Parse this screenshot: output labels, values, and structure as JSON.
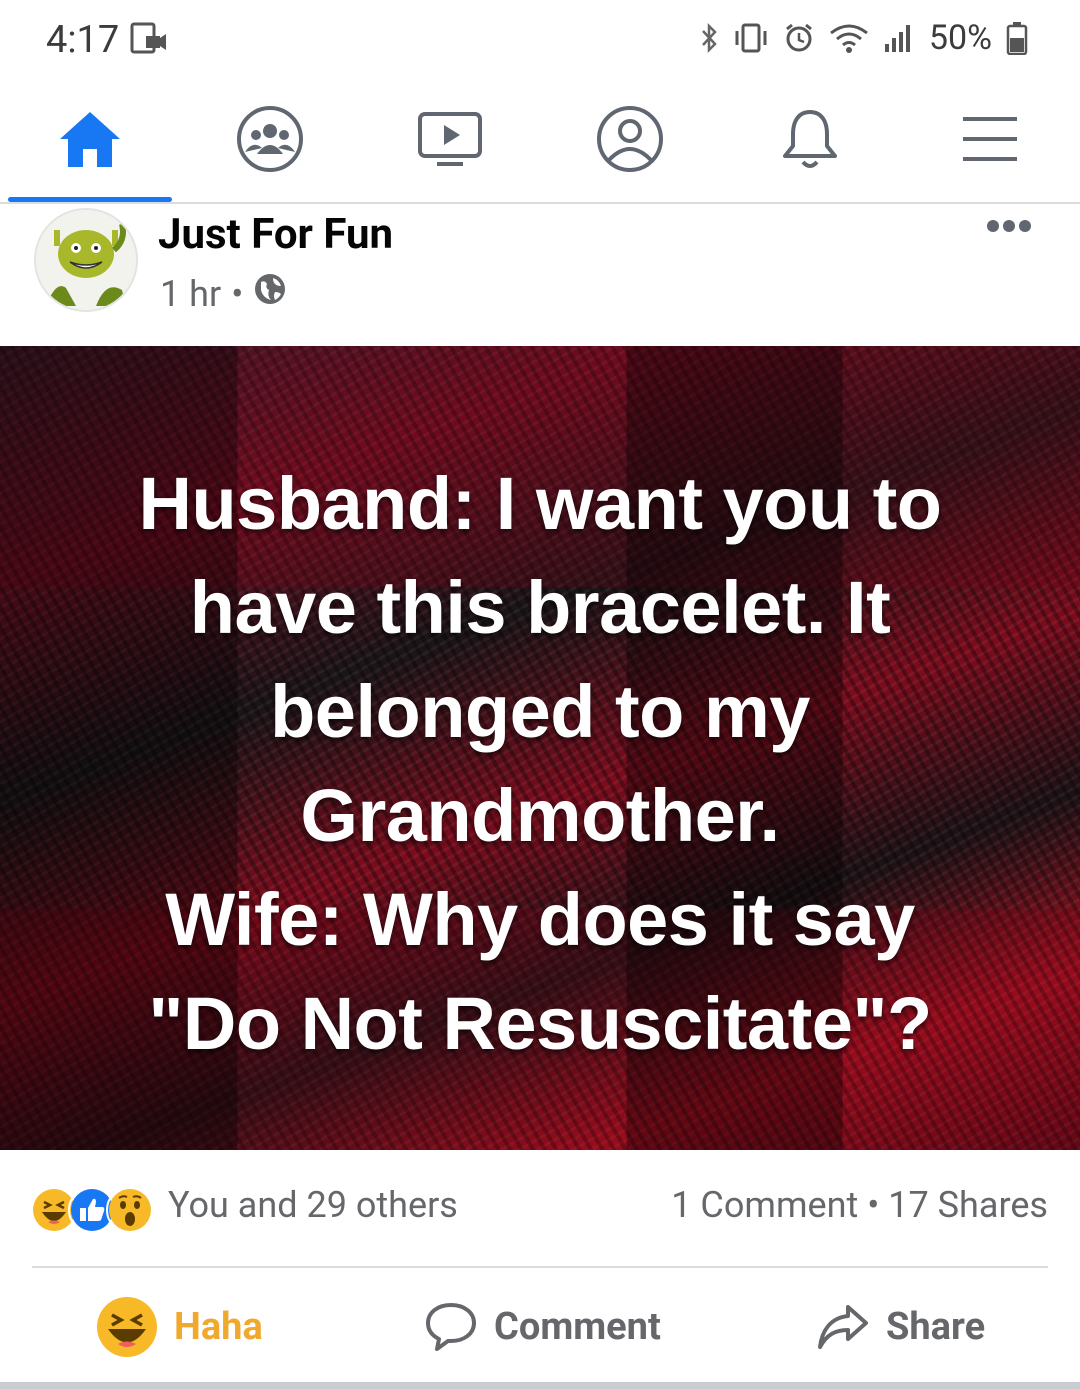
{
  "status_bar": {
    "time": "4:17",
    "battery": "50%"
  },
  "nav": {
    "active": "home",
    "items": [
      "home-icon",
      "groups-icon",
      "watch-icon",
      "profile-icon",
      "notifications-icon",
      "menu-icon"
    ],
    "accent": "#1877f2"
  },
  "post": {
    "page_name": "Just For Fun",
    "time_ago": "1 hr",
    "separator": "•",
    "audience_icon": "globe-icon",
    "image_text_lines": [
      "Husband: I want you to",
      "have this bracelet. It",
      "belonged to my",
      "Grandmother.",
      "Wife: Why does it say",
      "\"Do Not Resuscitate\"?"
    ],
    "reactions": {
      "icons": [
        "haha-icon",
        "like-icon",
        "wow-icon"
      ],
      "text": "You and 29 others"
    },
    "engagement": "1 Comment • 17 Shares",
    "actions": {
      "haha": "Haha",
      "comment": "Comment",
      "share": "Share"
    }
  },
  "colors": {
    "haha": "#f0a92e",
    "meta": "#65676b",
    "like_blue": "#1877f2"
  }
}
